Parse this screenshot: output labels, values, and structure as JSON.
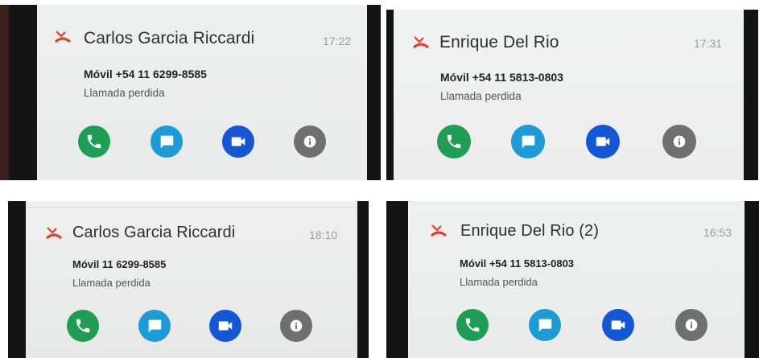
{
  "notifications": [
    {
      "name": "Carlos Garcia Riccardi",
      "time": "17:22",
      "number": "Móvil +54 11 6299-8585",
      "status": "Llamada perdida",
      "icons": [
        "missed-call-icon",
        "phone-icon",
        "message-icon",
        "video-icon",
        "info-icon"
      ]
    },
    {
      "name": "Enrique Del Rio",
      "time": "17:31",
      "number": "Móvil +54 11 5813-0803",
      "status": "Llamada perdida",
      "icons": [
        "missed-call-icon",
        "phone-icon",
        "message-icon",
        "video-icon",
        "info-icon"
      ]
    },
    {
      "name": "Carlos Garcia Riccardi",
      "time": "18:10",
      "number": "Móvil 11 6299-8585",
      "status": "Llamada perdida",
      "icons": [
        "missed-call-icon",
        "phone-icon",
        "message-icon",
        "video-icon",
        "info-icon"
      ]
    },
    {
      "name": "Enrique Del Rio (2)",
      "time": "16:53",
      "number": "Móvil +54 11 5813-0803",
      "status": "Llamada perdida",
      "icons": [
        "missed-call-icon",
        "phone-icon",
        "message-icon",
        "video-icon",
        "info-icon"
      ]
    }
  ],
  "colors": {
    "missed": "#e0402a",
    "call": "#1f9d55",
    "message": "#1e9bd7",
    "video": "#1357d6",
    "info": "#6f6f6f"
  }
}
